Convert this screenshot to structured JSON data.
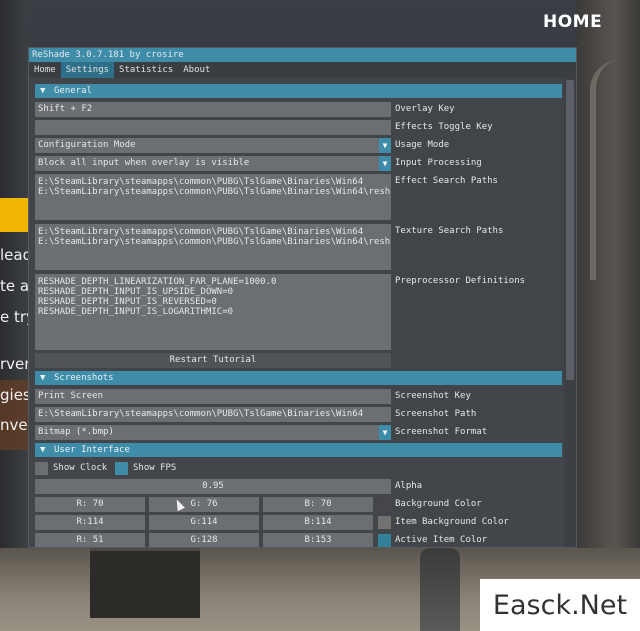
{
  "background": {
    "home_title": "HOME",
    "side_text": [
      "lead",
      "te a",
      "e try",
      "rver",
      "gies",
      "nve"
    ],
    "watermark": "Easck.Net"
  },
  "window": {
    "title": "ReShade 3.0.7.181 by crosire",
    "tabs": [
      {
        "label": "Home",
        "active": false
      },
      {
        "label": "Settings",
        "active": true
      },
      {
        "label": "Statistics",
        "active": false
      },
      {
        "label": "About",
        "active": false
      }
    ]
  },
  "general": {
    "header": "General",
    "overlay_key": {
      "value": "Shift + F2",
      "label": "Overlay Key"
    },
    "effects_toggle_key": {
      "value": "",
      "label": "Effects Toggle Key"
    },
    "usage_mode": {
      "value": "Configuration Mode",
      "label": "Usage Mode"
    },
    "input_processing": {
      "value": "Block all input when overlay is visible",
      "label": "Input Processing"
    },
    "effect_search_paths": {
      "value": "E:\\SteamLibrary\\steamapps\\common\\PUBG\\TslGame\\Binaries\\Win64\nE:\\SteamLibrary\\steamapps\\common\\PUBG\\TslGame\\Binaries\\Win64\\resh",
      "label": "Effect Search Paths"
    },
    "texture_search_paths": {
      "value": "E:\\SteamLibrary\\steamapps\\common\\PUBG\\TslGame\\Binaries\\Win64\nE:\\SteamLibrary\\steamapps\\common\\PUBG\\TslGame\\Binaries\\Win64\\resh",
      "label": "Texture Search Paths"
    },
    "preprocessor_definitions": {
      "value": "RESHADE_DEPTH_LINEARIZATION_FAR_PLANE=1000.0\nRESHADE_DEPTH_INPUT_IS_UPSIDE_DOWN=0\nRESHADE_DEPTH_INPUT_IS_REVERSED=0\nRESHADE_DEPTH_INPUT_IS_LOGARITHMIC=0",
      "label": "Preprocessor Definitions"
    },
    "restart_tutorial": "Restart Tutorial"
  },
  "screenshots": {
    "header": "Screenshots",
    "key": {
      "value": "Print Screen",
      "label": "Screenshot Key"
    },
    "path": {
      "value": "E:\\SteamLibrary\\steamapps\\common\\PUBG\\TslGame\\Binaries\\Win64",
      "label": "Screenshot Path"
    },
    "format": {
      "value": "Bitmap (*.bmp)",
      "label": "Screenshot Format"
    }
  },
  "user_interface": {
    "header": "User Interface",
    "show_clock": {
      "label": "Show Clock",
      "checked": false
    },
    "show_fps": {
      "label": "Show FPS",
      "checked": true
    },
    "alpha": {
      "value": "0.95",
      "label": "Alpha"
    },
    "background_color": {
      "label": "Background Color",
      "r": "R: 70",
      "g": "G: 76",
      "b": "B: 70",
      "swatch": "#46464a"
    },
    "item_background_color": {
      "label": "Item Background Color",
      "r": "R:114",
      "g": "G:114",
      "b": "B:114",
      "swatch": "#727272"
    },
    "active_item_color": {
      "label": "Active Item Color",
      "r": "R: 51",
      "g": "G:128",
      "b": "B:153",
      "swatch": "#338099"
    }
  },
  "colors": {
    "accent": "#3f8ca8",
    "window_bg": "#42464a",
    "field_bg": "#6b6f73"
  }
}
